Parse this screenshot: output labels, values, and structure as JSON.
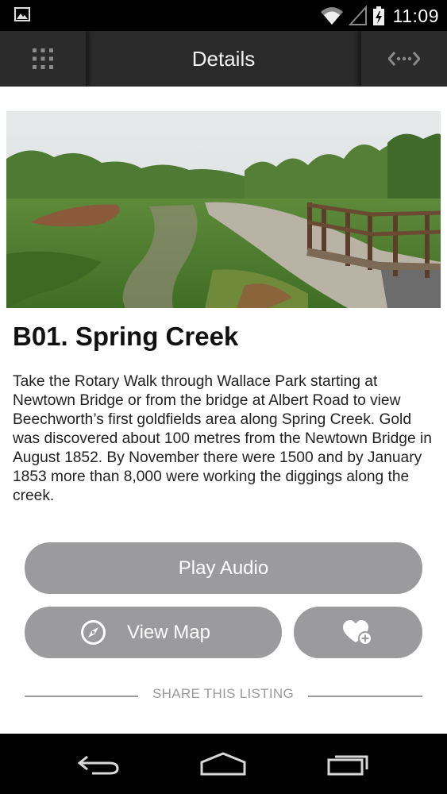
{
  "status_bar": {
    "time": "11:09",
    "icons": [
      "image-notification-icon",
      "wifi-icon",
      "cell-signal-icon",
      "battery-charging-icon"
    ]
  },
  "action_bar": {
    "title": "Details",
    "left_icon": "grid-menu-icon",
    "right_icon": "share-connect-icon"
  },
  "listing": {
    "title": "B01. Spring Creek",
    "description": "Take the Rotary Walk through Wallace Park starting at Newtown Bridge or from the bridge at Albert Road to view Beechworth’s first goldfields area along Spring Creek. Gold was discovered about 100 metres from the Newtown Bridge in August 1852. By November there were 1500 and by January 1853 more than 8,000 were working the diggings along the creek.",
    "image_icon": "park-path-bridge-photo"
  },
  "buttons": {
    "play_audio": "Play Audio",
    "view_map": "View Map",
    "view_map_icon": "compass-icon",
    "favourite_icon": "heart-add-icon"
  },
  "share": {
    "label": "SHARE THIS LISTING"
  },
  "nav_bar": {
    "icons": [
      "back-icon",
      "home-icon",
      "recents-icon"
    ]
  },
  "colors": {
    "button_bg": "#9b9a9c",
    "action_bar_bg": "#2a2a2a",
    "status_bar_bg": "#000000"
  }
}
